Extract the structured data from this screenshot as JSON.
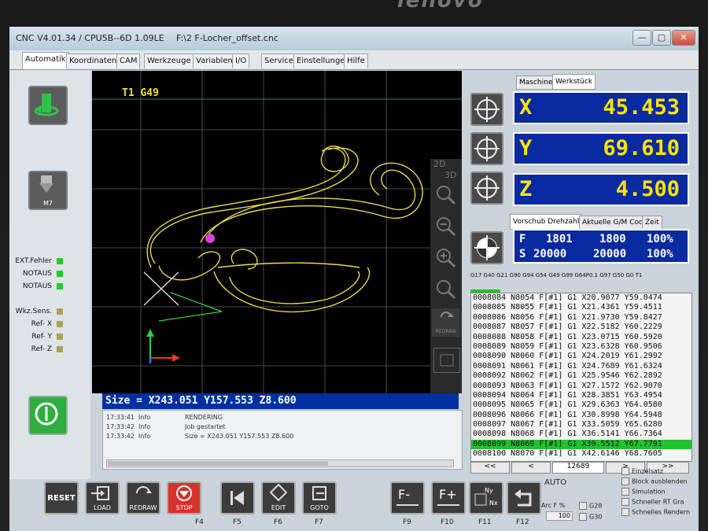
{
  "brand": "lenovo",
  "window": {
    "title_app": "CNC V4.01.34 / CPU5B--6D 1.09LE",
    "title_file": "F:\\2 F-Locher_offset.cnc",
    "min": "—",
    "max": "▢",
    "close": "✕"
  },
  "menu": [
    "Automatik",
    "Koordinaten",
    "CAM",
    "Werkzeuge",
    "Variablen",
    "I/O",
    "Service",
    "Einstellungen",
    "Hilfe"
  ],
  "viewport": {
    "tool_label": "T1  G49",
    "view_2d": "2D",
    "view_3d": "3D",
    "redraw": "REDRAW"
  },
  "left": {
    "m7": "M7",
    "status": [
      {
        "label": "EXT.Fehler",
        "color": "#22cc22"
      },
      {
        "label": "NOTAUS",
        "color": "#22cc22"
      },
      {
        "label": "NOTAUS",
        "color": "#22cc22"
      }
    ],
    "sensors": [
      {
        "label": "Wkz.Sens.",
        "color": "#aaa25a"
      },
      {
        "label": "Ref- X",
        "color": "#aaa25a"
      },
      {
        "label": "Ref- Y",
        "color": "#aaa25a"
      },
      {
        "label": "Ref- Z",
        "color": "#aaa25a"
      }
    ]
  },
  "status": "Size = X243.051 Y157.553 Z8.600",
  "log": [
    {
      "time": "17:33:41",
      "level": "Info",
      "msg": "RENDERING"
    },
    {
      "time": "17:33:42",
      "level": "Info",
      "msg": "Job gestartet"
    },
    {
      "time": "17:33:42",
      "level": "Info",
      "msg": "Size = X243.051 Y157.553 Z8.600"
    }
  ],
  "coord_tabs": [
    "Maschine",
    "Werkstück"
  ],
  "axes": [
    {
      "axis": "X",
      "value": "45.453"
    },
    {
      "axis": "Y",
      "value": "69.610"
    },
    {
      "axis": "Z",
      "value": "4.500"
    }
  ],
  "feed_tabs": [
    "Vorschub Drehzahl",
    "Aktuelle G/M Code",
    "Zeit"
  ],
  "feed": {
    "f_label": "F",
    "f_set": "1801",
    "f_act": "1800",
    "f_pct": "100%",
    "s_label": "S",
    "s_set": "20000",
    "s_act": "20000",
    "s_pct": "100%"
  },
  "modal_codes": "G17 G40 G21 G90 G94 G54 G49 G99 G64P0.1 G97 G50 G0 T1",
  "gcode": [
    "0008084 N8054 F[#1] G1 X20.9077 Y59.0474",
    "0008085 N8055 F[#1] G1 X21.4361 Y59.4511",
    "0008086 N8056 F[#1] G1 X21.9730 Y59.8427",
    "0008087 N8057 F[#1] G1 X22.5182 Y60.2229",
    "0008088 N8058 F[#1] G1 X23.0715 Y60.5920",
    "0008089 N8059 F[#1] G1 X23.6328 Y60.9506",
    "0008090 N8060 F[#1] G1 X24.2019 Y61.2992",
    "0008091 N8061 F[#1] G1 X24.7689 Y61.6324",
    "0008092 N8062 F[#1] G1 X25.9546 Y62.2892",
    "0008093 N8063 F[#1] G1 X27.1572 Y62.9070",
    "0008094 N8064 F[#1] G1 X28.3851 Y63.4954",
    "0008095 N8065 F[#1] G1 X29.6363 Y64.0580",
    "0008096 N8066 F[#1] G1 X30.8998 Y64.5948",
    "0008097 N8067 F[#1] G1 X33.5059 Y65.6280",
    "0008098 N8068 F[#1] G1 X36.5141 Y66.7364",
    "0008099 N8069 F[#1] G1 X39.5512 Y67.7791",
    "0008100 N8070 F[#1] G1 X42.6146 Y68.7605"
  ],
  "gcode_highlight": 15,
  "gnav": {
    "first": "<<",
    "prev": "<",
    "line": "12689",
    "next": ">",
    "last": ">>"
  },
  "bottom": {
    "reset": "RESET",
    "load": "LOAD",
    "redraw": "REDRAW",
    "stop": "STOP",
    "f4": "F4",
    "edit": "EDIT",
    "goto": "GOTO",
    "f5": "F5",
    "f6": "F6",
    "f7": "F7",
    "f9": "F9",
    "f10": "F10",
    "f11": "F11",
    "f12": "F12",
    "auto": "AUTO",
    "arc_label": "Arc F %",
    "arc_value": "100",
    "g28": "G28",
    "g30": "G30"
  },
  "options": [
    "Einzelsatz",
    "Block ausblenden",
    "Simulation",
    "Schneller RT Gra",
    "Schnelles Rendern"
  ]
}
